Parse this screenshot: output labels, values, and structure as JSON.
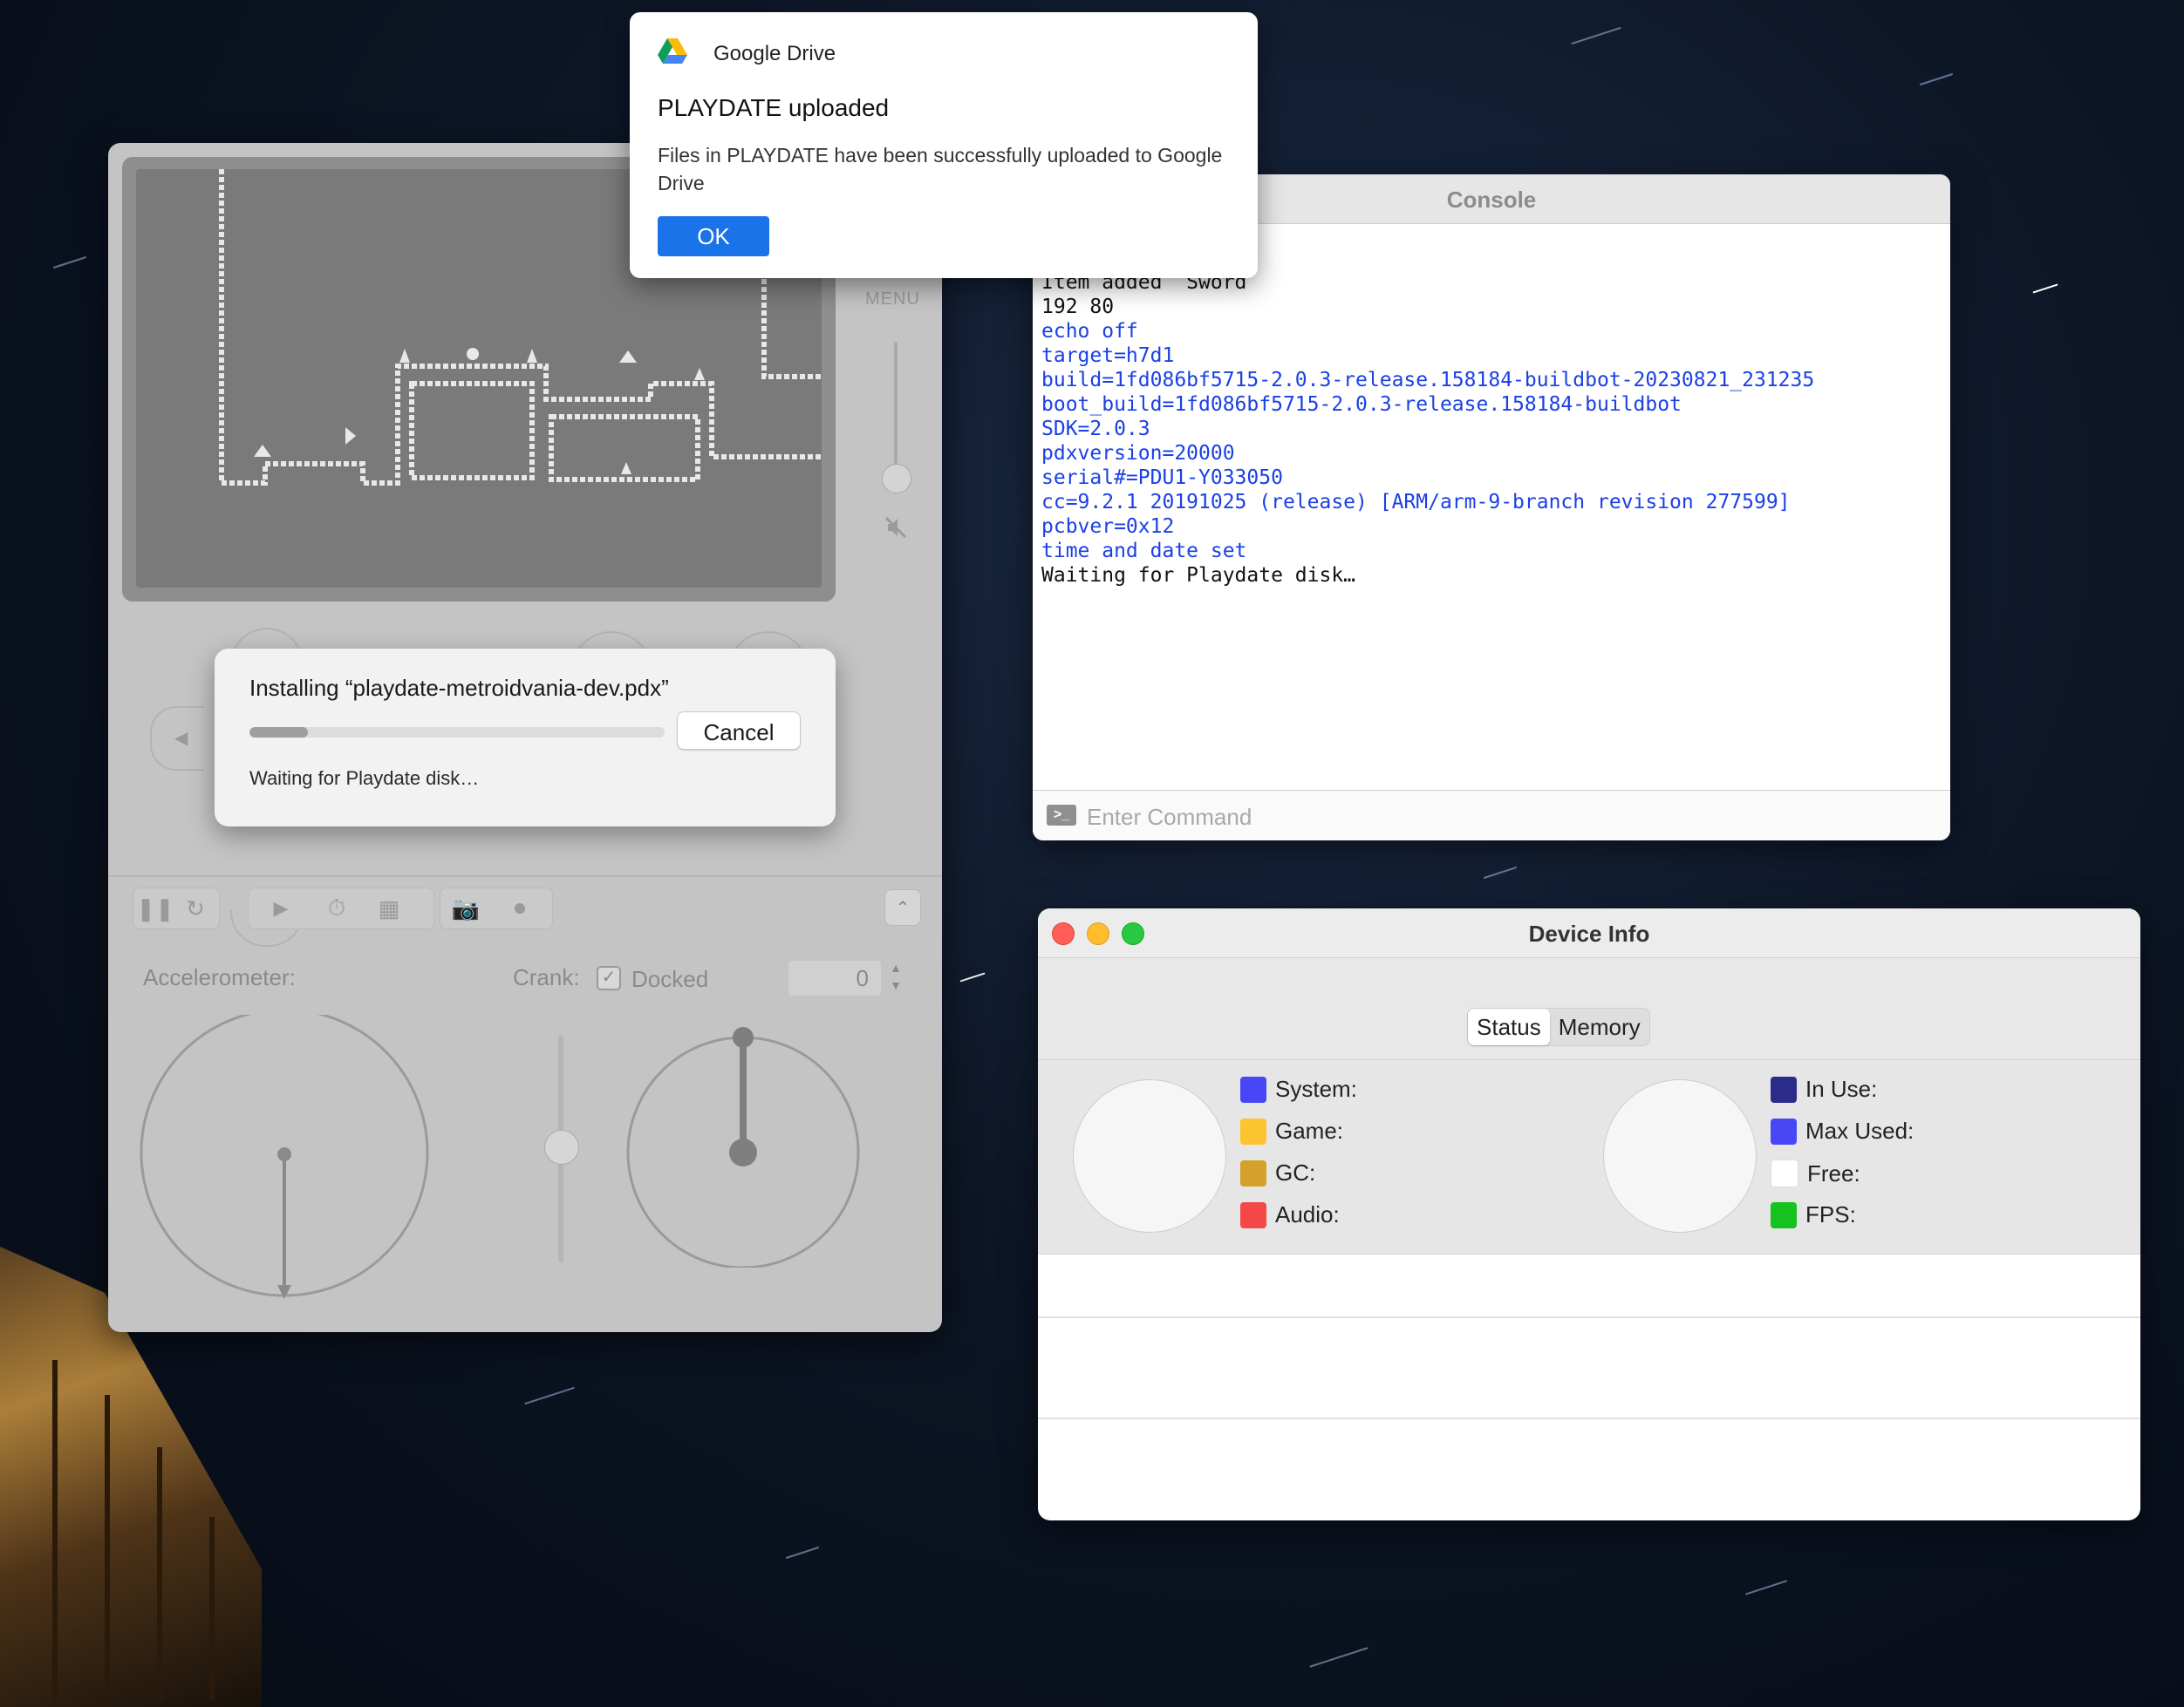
{
  "gdrive": {
    "app_name": "Google Drive",
    "title": "PLAYDATE uploaded",
    "body": "Files in PLAYDATE have been successfully uploaded to Google Drive",
    "ok_label": "OK"
  },
  "simulator": {
    "menu_label": "MENU",
    "accelerometer_label": "Accelerometer:",
    "crank_label": "Crank:",
    "docked_label": "Docked",
    "docked_checked": true,
    "crank_value": "0"
  },
  "install_dialog": {
    "title": "Installing “playdate-metroidvania-dev.pdx”",
    "progress": 0.14,
    "cancel_label": "Cancel",
    "status": "Waiting for Playdate disk…"
  },
  "console": {
    "title": "Console",
    "lines": [
      {
        "text": "Item added  Sword",
        "color": "#111111"
      },
      {
        "text": "192 80",
        "color": "#111111"
      },
      {
        "text": "echo off",
        "color": "#1a40e6"
      },
      {
        "text": "target=h7d1",
        "color": "#1a40e6"
      },
      {
        "text": "build=1fd086bf5715-2.0.3-release.158184-buildbot-20230821_231235",
        "color": "#1a40e6"
      },
      {
        "text": "boot_build=1fd086bf5715-2.0.3-release.158184-buildbot",
        "color": "#1a40e6"
      },
      {
        "text": "SDK=2.0.3",
        "color": "#1a40e6"
      },
      {
        "text": "pdxversion=20000",
        "color": "#1a40e6"
      },
      {
        "text": "serial#=PDU1-Y033050",
        "color": "#1a40e6"
      },
      {
        "text": "cc=9.2.1 20191025 (release) [ARM/arm-9-branch revision 277599]",
        "color": "#1a40e6"
      },
      {
        "text": "pcbver=0x12",
        "color": "#1a40e6"
      },
      {
        "text": "time and date set",
        "color": "#1a40e6"
      },
      {
        "text": "Waiting for Playdate disk…",
        "color": "#111111"
      }
    ],
    "command_placeholder": "Enter Command"
  },
  "device_info": {
    "title": "Device Info",
    "tabs": [
      {
        "label": "Status",
        "active": true
      },
      {
        "label": "Memory",
        "active": false
      }
    ],
    "cpu_legend": [
      {
        "label": "System:",
        "color": "#4747f5"
      },
      {
        "label": "Game:",
        "color": "#fcc42f"
      },
      {
        "label": "GC:",
        "color": "#d4a22a"
      },
      {
        "label": "Audio:",
        "color": "#f44848"
      }
    ],
    "memory_legend": [
      {
        "label": "In Use:",
        "color": "#2b2c8a"
      },
      {
        "label": "Max Used:",
        "color": "#4747f5"
      },
      {
        "label": "Free:",
        "color": "#ffffff"
      },
      {
        "label": "FPS:",
        "color": "#16c21d"
      }
    ]
  }
}
